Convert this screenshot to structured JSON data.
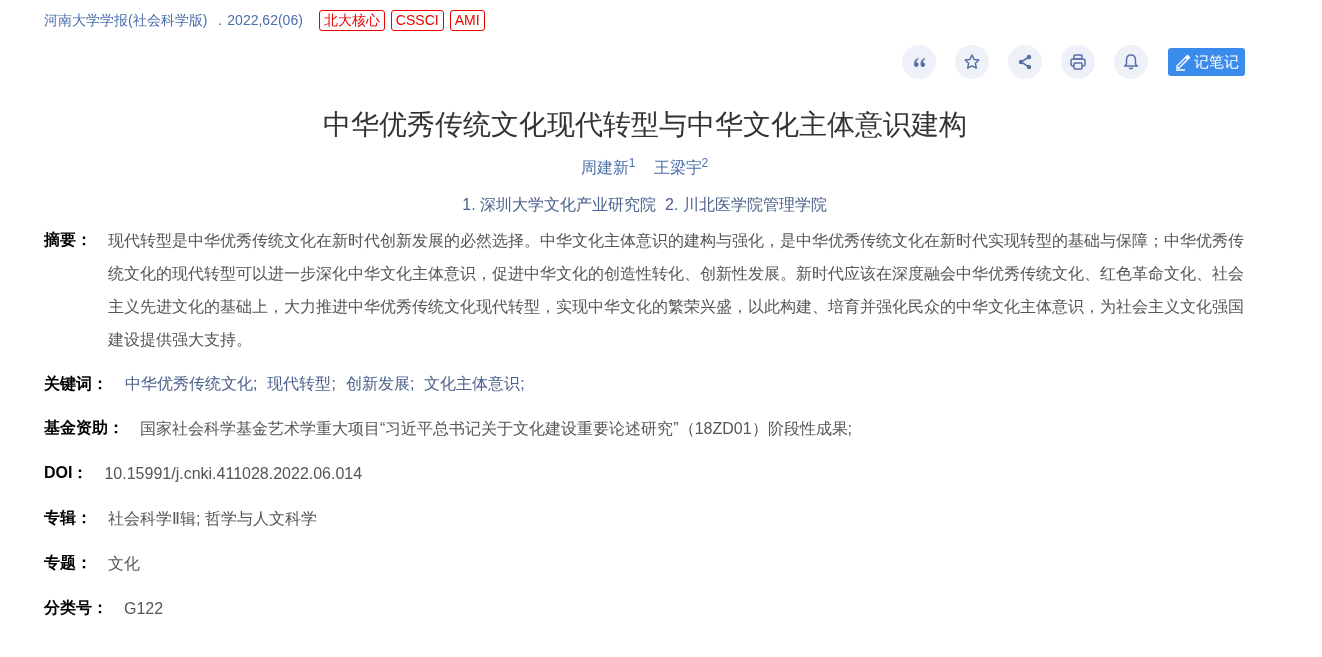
{
  "source": {
    "journal": "河南大学学报(社会科学版)",
    "issue": "．2022,62(06)",
    "tags": [
      "北大核心",
      "CSSCI",
      "AMI"
    ]
  },
  "toolbar": {
    "icons": [
      {
        "kind": "quote"
      },
      {
        "kind": "star"
      },
      {
        "kind": "share"
      },
      {
        "kind": "print"
      },
      {
        "kind": "bell"
      }
    ],
    "note_button": "记笔记"
  },
  "title": "中华优秀传统文化现代转型与中华文化主体意识建构",
  "authors": [
    "周建新$^{1}$",
    "王梁宇$^{2}$"
  ],
  "affiliations": "1. 深圳大学文化产业研究院  2. 川北医学院管理学院",
  "fields": [
    {
      "kind": "text",
      "label": "摘要：",
      "value": "现代转型是中华优秀传统文化在新时代创新发展的必然选择。中华文化主体意识的建构与强化，是中华优秀传统文化在新时代实现转型的基础与保障；中华优秀传统文化的现代转型可以进一步深化中华文化主体意识，促进中华文化的创造性转化、创新性发展。新时代应该在深度融会中华优秀传统文化、红色革命文化、社会主义先进文化的基础上，大力推进中华优秀传统文化现代转型，实现中华文化的繁荣兴盛，以此构建、培育并强化民众的中华文化主体意识，为社会主义文化强国建设提供强大支持。"
    },
    {
      "kind": "links",
      "label": "关键词：",
      "items": [
        "中华优秀传统文化;",
        "现代转型;",
        "创新发展;",
        "文化主体意识;"
      ]
    },
    {
      "kind": "text",
      "label": "基金资助：",
      "value": "国家社会科学基金艺术学重大项目“习近平总书记关于文化建设重要论述研究”（18ZD01）阶段性成果;"
    },
    {
      "kind": "text",
      "label": "DOI：",
      "value": "10.15991/j.cnki.411028.2022.06.014"
    },
    {
      "kind": "text",
      "label": "专辑：",
      "value": "社会科学Ⅱ辑; 哲学与人文科学"
    },
    {
      "kind": "text",
      "label": "专题：",
      "value": "文化"
    },
    {
      "kind": "text",
      "label": "分类号：",
      "value": "G122"
    }
  ]
}
